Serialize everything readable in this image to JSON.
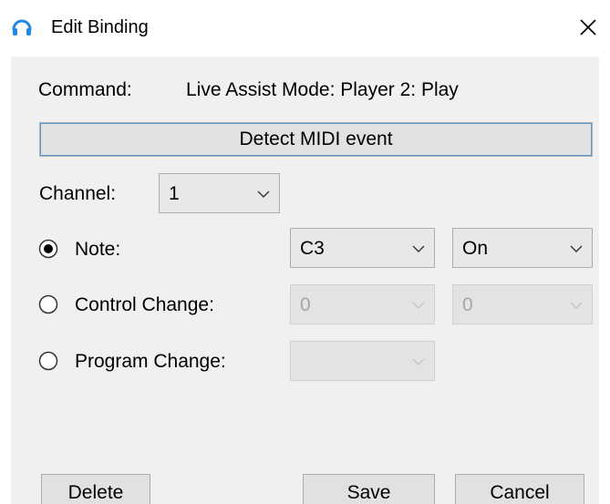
{
  "window": {
    "title": "Edit Binding",
    "app_icon": "headphones-icon",
    "close_icon": "close-icon"
  },
  "command": {
    "label": "Command:",
    "value": "Live Assist Mode: Player 2: Play"
  },
  "detect_button": {
    "label": "Detect MIDI event"
  },
  "channel": {
    "label": "Channel:",
    "value": "1"
  },
  "options": {
    "note": {
      "label": "Note:",
      "selected": true,
      "value": "C3",
      "state": "On",
      "enabled": true
    },
    "control_change": {
      "label": "Control Change:",
      "selected": false,
      "value": "0",
      "value2": "0",
      "enabled": false
    },
    "program_change": {
      "label": "Program Change:",
      "selected": false,
      "value": "",
      "enabled": false
    }
  },
  "buttons": {
    "delete": "Delete",
    "save": "Save",
    "cancel": "Cancel"
  },
  "colors": {
    "client_bg": "#f0f0f0",
    "button_face": "#e1e1e1",
    "button_border": "#adadad",
    "focus_accent": "#5b9bd5",
    "icon_blue": "#1e88e5",
    "disabled_text": "#a6a6a6"
  }
}
